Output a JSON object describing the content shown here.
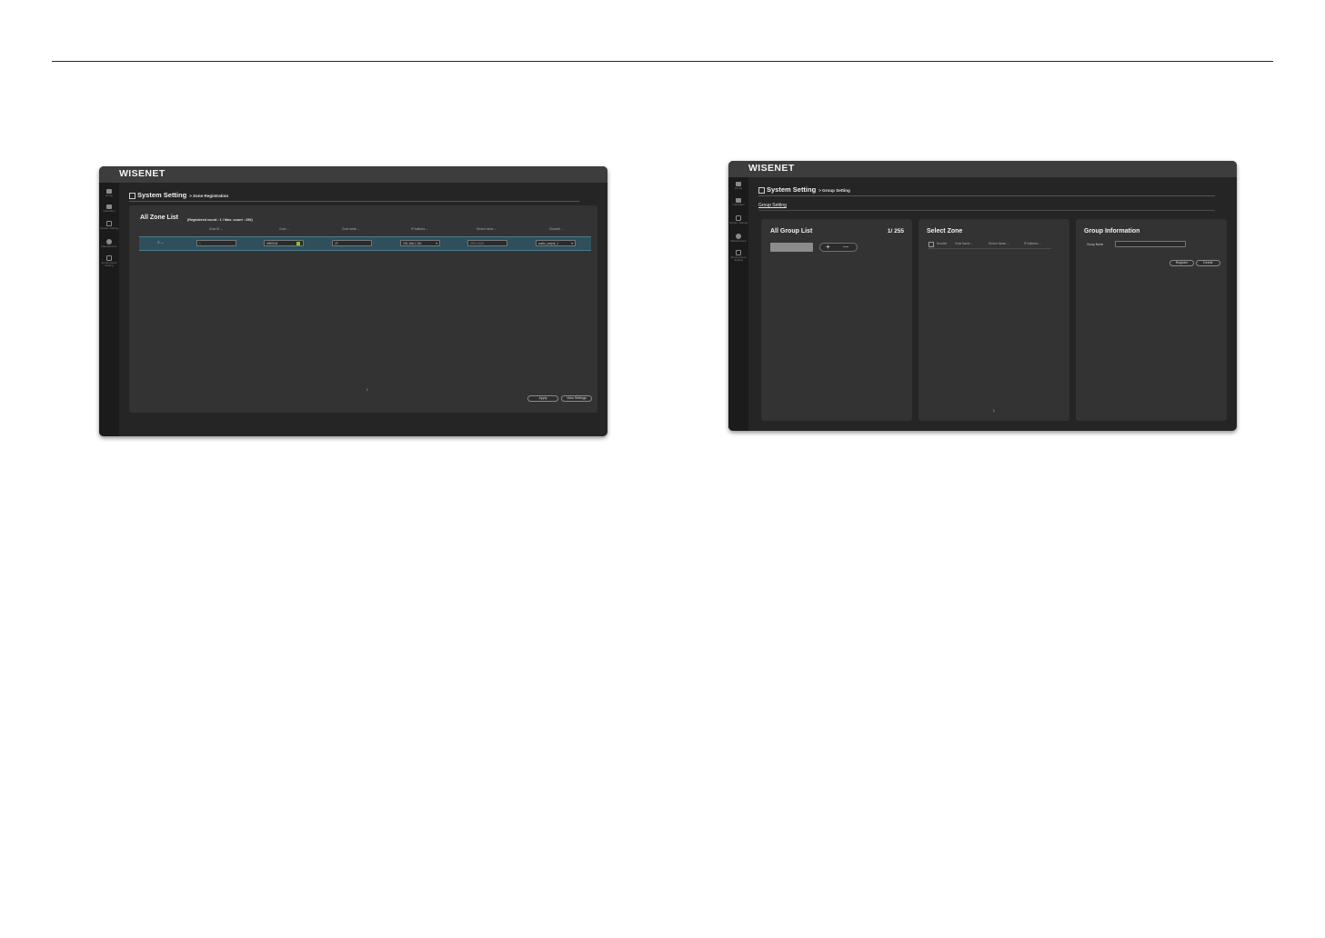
{
  "brand": "WISENET",
  "sidebar": [
    {
      "label": "Home",
      "icon": "home-icon"
    },
    {
      "label": "Operation",
      "icon": "calendar-icon"
    },
    {
      "label": "System Setting",
      "icon": "settings-box-icon"
    },
    {
      "label": "Maintenance",
      "icon": "wrench-icon"
    },
    {
      "label": "Environment Setting",
      "icon": "environment-icon"
    }
  ],
  "zone_screen": {
    "header_title": "System Setting",
    "header_sub": "> Zone Registration",
    "panel_title": "All Zone List",
    "count_text": "(Registered count : 1 / Max. count : 256)",
    "columns": [
      "Zone ID",
      "Color",
      "Zone name",
      "IP Address",
      "Device name",
      "Channel"
    ],
    "row": {
      "select": "☰ —",
      "zone_id": "1",
      "color": "#990044",
      "zone_name": "1F",
      "ip": "192.168.1.100",
      "device_name": "XRN-410S",
      "channel": "audio_output_1"
    },
    "page": "1",
    "apply_label": "Apply",
    "view_settings_label": "View Settings"
  },
  "group_screen": {
    "header_title": "System Setting",
    "header_sub": "> Group Setting",
    "tab_label": "Group Setting",
    "all_group_title": "All Group List",
    "group_count": "1/ 255",
    "add_symbol": "+",
    "remove_symbol": "—",
    "select_zone_title": "Select Zone",
    "select_zone_columns": [
      "Number",
      "Zone Name",
      "Device Name",
      "IP Address"
    ],
    "select_zone_page": "1",
    "group_info_title": "Group Information",
    "group_name_label": "Group Name",
    "register_label": "Register",
    "delete_label": "Delete"
  },
  "colors": {
    "accent_row": "#2f4f5c",
    "color_swatch": "#86c232"
  }
}
